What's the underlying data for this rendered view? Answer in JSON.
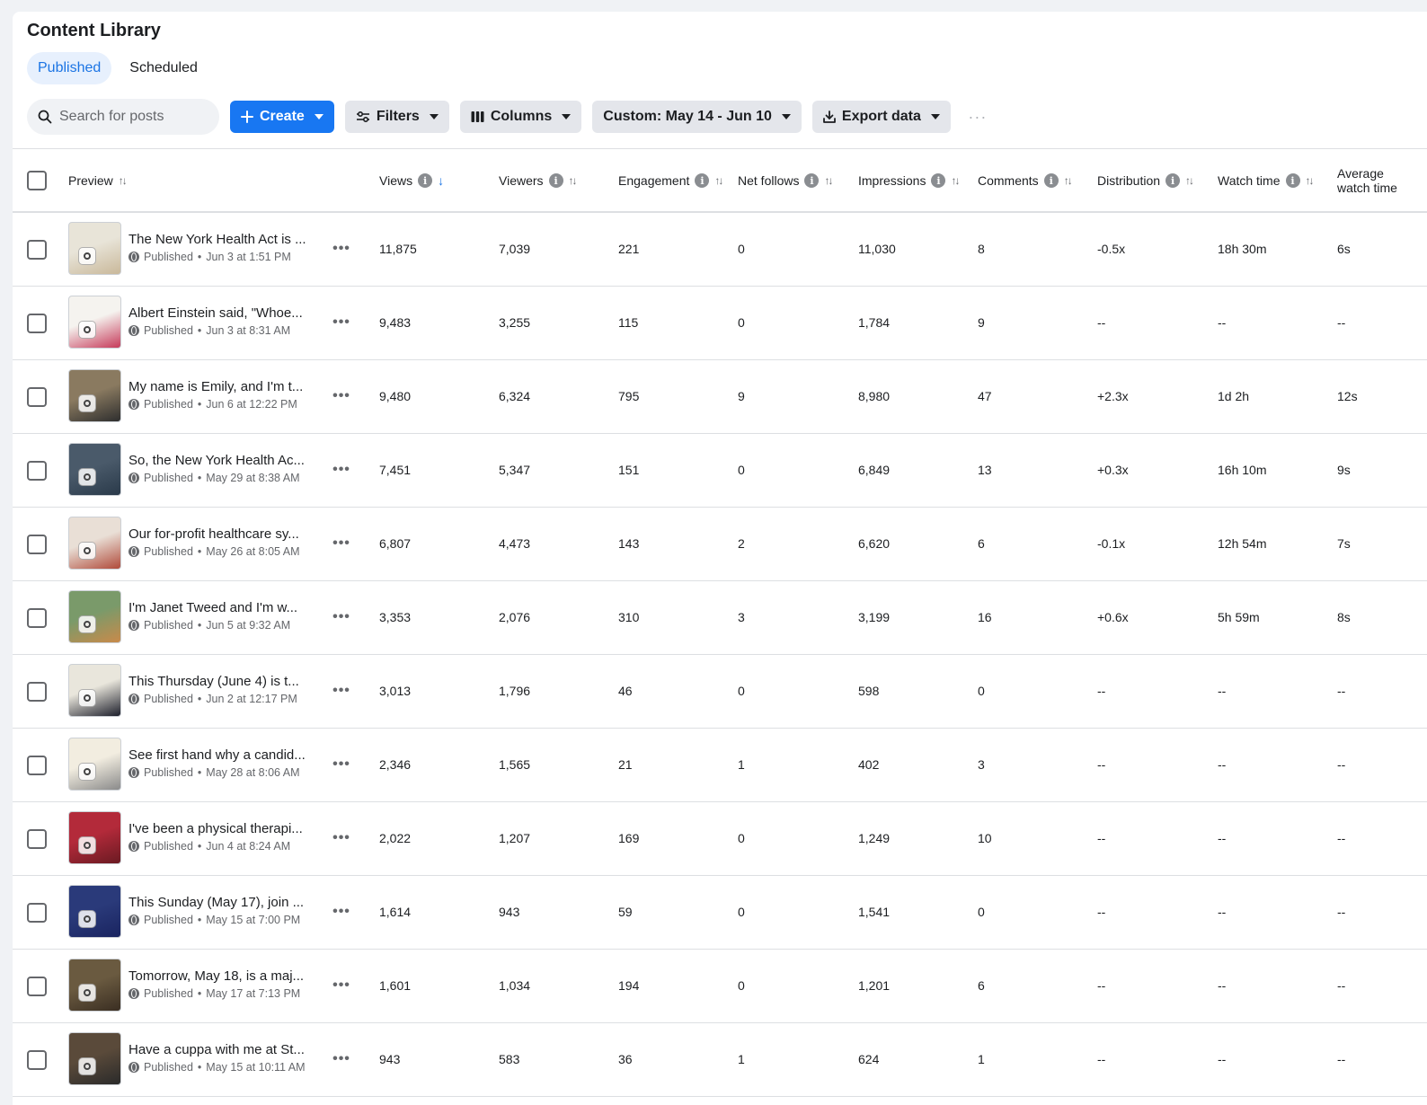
{
  "page_title": "Content Library",
  "tabs": [
    {
      "label": "Published",
      "active": true
    },
    {
      "label": "Scheduled",
      "active": false
    }
  ],
  "search": {
    "placeholder": "Search for posts",
    "value": ""
  },
  "toolbar": {
    "create_label": "Create",
    "filters_label": "Filters",
    "columns_label": "Columns",
    "date_range_label": "Custom: May 14 - Jun 10",
    "export_label": "Export data",
    "more_label": "···"
  },
  "colors": {
    "accent": "#1877f2",
    "active_tab_bg": "#e7f0fd",
    "active_tab_text": "#1b74e4"
  },
  "columns": {
    "preview": "Preview",
    "views": "Views",
    "viewers": "Viewers",
    "engagement": "Engagement",
    "net_follows": "Net follows",
    "impressions": "Impressions",
    "comments": "Comments",
    "distribution": "Distribution",
    "watch_time": "Watch time",
    "avg_watch_time_1": "Average",
    "avg_watch_time_2": "watch time"
  },
  "sorted_by": "views",
  "row_more_label": "•••",
  "rows": [
    {
      "title": "The New York Health Act is ...",
      "status": "Published",
      "date": "Jun 3 at 1:51 PM",
      "views": "11,875",
      "viewers": "7,039",
      "engagement": "221",
      "net_follows": "0",
      "impressions": "11,030",
      "comments": "8",
      "distribution": "-0.5x",
      "watch_time": "18h 30m",
      "avg_watch_time": "6s",
      "thumb_colors": [
        "#e8e4d8",
        "#c9b89a"
      ]
    },
    {
      "title": "Albert Einstein said, \"Whoe...",
      "status": "Published",
      "date": "Jun 3 at 8:31 AM",
      "views": "9,483",
      "viewers": "3,255",
      "engagement": "115",
      "net_follows": "0",
      "impressions": "1,784",
      "comments": "9",
      "distribution": "--",
      "watch_time": "--",
      "avg_watch_time": "--",
      "thumb_colors": [
        "#f5f3ef",
        "#c63a5a"
      ]
    },
    {
      "title": "My name is Emily, and I'm t...",
      "status": "Published",
      "date": "Jun 6 at 12:22 PM",
      "views": "9,480",
      "viewers": "6,324",
      "engagement": "795",
      "net_follows": "9",
      "impressions": "8,980",
      "comments": "47",
      "distribution": "+2.3x",
      "watch_time": "1d 2h",
      "avg_watch_time": "12s",
      "thumb_colors": [
        "#8a7a60",
        "#2e2e2e"
      ]
    },
    {
      "title": "So, the New York Health Ac...",
      "status": "Published",
      "date": "May 29 at 8:38 AM",
      "views": "7,451",
      "viewers": "5,347",
      "engagement": "151",
      "net_follows": "0",
      "impressions": "6,849",
      "comments": "13",
      "distribution": "+0.3x",
      "watch_time": "16h 10m",
      "avg_watch_time": "9s",
      "thumb_colors": [
        "#4a5a6a",
        "#2a3a4a"
      ]
    },
    {
      "title": "Our for-profit healthcare sy...",
      "status": "Published",
      "date": "May 26 at 8:05 AM",
      "views": "6,807",
      "viewers": "4,473",
      "engagement": "143",
      "net_follows": "2",
      "impressions": "6,620",
      "comments": "6",
      "distribution": "-0.1x",
      "watch_time": "12h 54m",
      "avg_watch_time": "7s",
      "thumb_colors": [
        "#e9dfd6",
        "#b04a3a"
      ]
    },
    {
      "title": "I'm Janet Tweed and I'm w...",
      "status": "Published",
      "date": "Jun 5 at 9:32 AM",
      "views": "3,353",
      "viewers": "2,076",
      "engagement": "310",
      "net_follows": "3",
      "impressions": "3,199",
      "comments": "16",
      "distribution": "+0.6x",
      "watch_time": "5h 59m",
      "avg_watch_time": "8s",
      "thumb_colors": [
        "#7a9a6a",
        "#c98a4a"
      ]
    },
    {
      "title": "This Thursday (June 4) is t...",
      "status": "Published",
      "date": "Jun 2 at 12:17 PM",
      "views": "3,013",
      "viewers": "1,796",
      "engagement": "46",
      "net_follows": "0",
      "impressions": "598",
      "comments": "0",
      "distribution": "--",
      "watch_time": "--",
      "avg_watch_time": "--",
      "thumb_colors": [
        "#e9e6dc",
        "#1c1e2a"
      ]
    },
    {
      "title": "See first hand why a candid...",
      "status": "Published",
      "date": "May 28 at 8:06 AM",
      "views": "2,346",
      "viewers": "1,565",
      "engagement": "21",
      "net_follows": "1",
      "impressions": "402",
      "comments": "3",
      "distribution": "--",
      "watch_time": "--",
      "avg_watch_time": "--",
      "thumb_colors": [
        "#f2ede0",
        "#8a8a8a"
      ]
    },
    {
      "title": "I've been a physical therapi...",
      "status": "Published",
      "date": "Jun 4 at 8:24 AM",
      "views": "2,022",
      "viewers": "1,207",
      "engagement": "169",
      "net_follows": "0",
      "impressions": "1,249",
      "comments": "10",
      "distribution": "--",
      "watch_time": "--",
      "avg_watch_time": "--",
      "thumb_colors": [
        "#b32a3a",
        "#6a1a22"
      ]
    },
    {
      "title": "This Sunday (May 17), join ...",
      "status": "Published",
      "date": "May 15 at 7:00 PM",
      "views": "1,614",
      "viewers": "943",
      "engagement": "59",
      "net_follows": "0",
      "impressions": "1,541",
      "comments": "0",
      "distribution": "--",
      "watch_time": "--",
      "avg_watch_time": "--",
      "thumb_colors": [
        "#2a3a7a",
        "#1a2460"
      ]
    },
    {
      "title": "Tomorrow, May 18, is a maj...",
      "status": "Published",
      "date": "May 17 at 7:13 PM",
      "views": "1,601",
      "viewers": "1,034",
      "engagement": "194",
      "net_follows": "0",
      "impressions": "1,201",
      "comments": "6",
      "distribution": "--",
      "watch_time": "--",
      "avg_watch_time": "--",
      "thumb_colors": [
        "#6a5a40",
        "#3a2e22"
      ]
    },
    {
      "title": "Have a cuppa with me at St...",
      "status": "Published",
      "date": "May 15 at 10:11 AM",
      "views": "943",
      "viewers": "583",
      "engagement": "36",
      "net_follows": "1",
      "impressions": "624",
      "comments": "1",
      "distribution": "--",
      "watch_time": "--",
      "avg_watch_time": "--",
      "thumb_colors": [
        "#5a4a3a",
        "#2a2a2a"
      ]
    }
  ]
}
